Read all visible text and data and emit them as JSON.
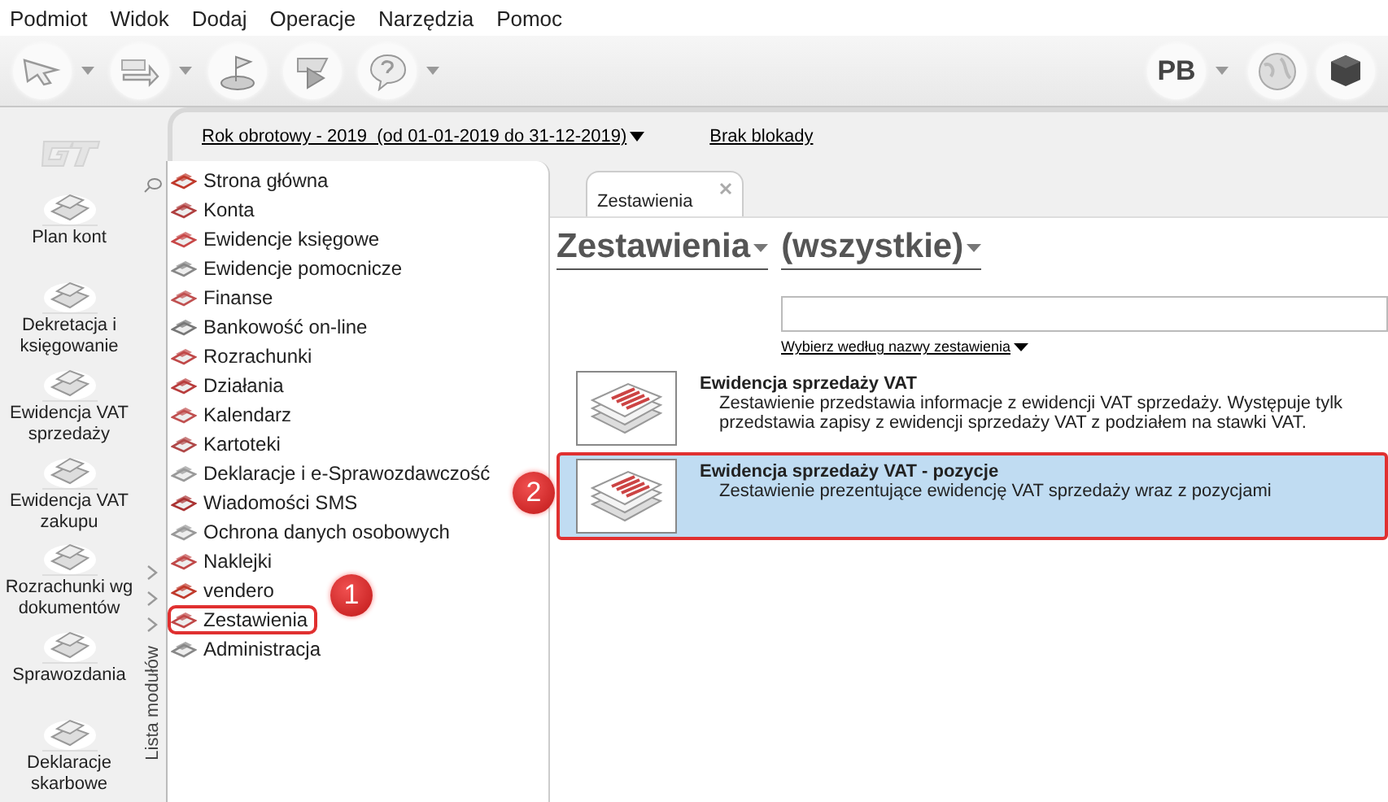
{
  "menu": [
    "Podmiot",
    "Widok",
    "Dodaj",
    "Operacje",
    "Narzędzia",
    "Pomoc"
  ],
  "toolbar": {
    "buttons": [
      {
        "dropdown": true
      },
      {
        "dropdown": true
      },
      {
        "dropdown": false
      },
      {
        "dropdown": false
      },
      {
        "dropdown": true
      }
    ],
    "user": {
      "initials": "PB",
      "dropdown": true
    }
  },
  "header": {
    "fiscal_year": "Rok obrotowy - 2019  (od 01-01-2019 do 31-12-2019)",
    "lock_status": "Brak blokady"
  },
  "rail": [
    "Plan kont",
    "Dekretacja i księgowanie",
    "Ewidencja VAT sprzedaży",
    "Ewidencja VAT zakupu",
    "Rozrachunki wg dokumentów",
    "Sprawozdania",
    "Deklaracje skarbowe"
  ],
  "modules": {
    "panel_label": "Lista modułów",
    "items": [
      {
        "label": "Strona główna",
        "highlighted": false
      },
      {
        "label": "Konta",
        "highlighted": false
      },
      {
        "label": "Ewidencje księgowe",
        "highlighted": false
      },
      {
        "label": "Ewidencje pomocnicze",
        "highlighted": false
      },
      {
        "label": "Finanse",
        "highlighted": false
      },
      {
        "label": "Bankowość on-line",
        "highlighted": false
      },
      {
        "label": "Rozrachunki",
        "highlighted": false
      },
      {
        "label": "Działania",
        "highlighted": false
      },
      {
        "label": "Kalendarz",
        "highlighted": false
      },
      {
        "label": "Kartoteki",
        "highlighted": false
      },
      {
        "label": "Deklaracje i e-Sprawozdawczość",
        "highlighted": false
      },
      {
        "label": "Wiadomości SMS",
        "highlighted": false
      },
      {
        "label": "Ochrona danych osobowych",
        "highlighted": false
      },
      {
        "label": "Naklejki",
        "highlighted": false
      },
      {
        "label": "vendero",
        "highlighted": false
      },
      {
        "label": "Zestawienia",
        "highlighted": true
      },
      {
        "label": "Administracja",
        "highlighted": false
      }
    ]
  },
  "tabs": [
    {
      "label": "Zestawienia",
      "selected": true
    }
  ],
  "content": {
    "title": "Zestawienia",
    "filter": "(wszystkie)",
    "sort_link": "Wybierz według nazwy zestawienia",
    "reports": [
      {
        "title": "Ewidencja sprzedaży VAT",
        "description": [
          "Zestawienie przedstawia informacje z ewidencji VAT sprzedaży. Występuje tylk",
          "przedstawia zapisy z ewidencji sprzedaży VAT z podziałem na stawki VAT."
        ],
        "selected": false,
        "highlighted": false
      },
      {
        "title": "Ewidencja sprzedaży VAT - pozycje",
        "description": [
          "Zestawienie prezentujące ewidencję VAT sprzedaży wraz z pozycjami"
        ],
        "selected": true,
        "highlighted": true
      }
    ]
  },
  "annotations": [
    {
      "number": "1"
    },
    {
      "number": "2"
    }
  ]
}
